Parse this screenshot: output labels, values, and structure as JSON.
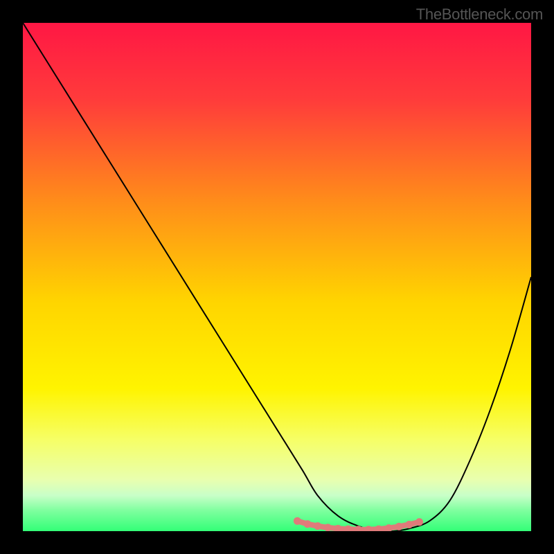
{
  "watermark": "TheBottleneck.com",
  "chart_data": {
    "type": "line",
    "title": "",
    "xlabel": "",
    "ylabel": "",
    "xlim": [
      0,
      100
    ],
    "ylim": [
      0,
      100
    ],
    "gradient_stops": [
      {
        "offset": 0,
        "color": "#ff1744"
      },
      {
        "offset": 15,
        "color": "#ff3b3b"
      },
      {
        "offset": 35,
        "color": "#ff8c1a"
      },
      {
        "offset": 55,
        "color": "#ffd500"
      },
      {
        "offset": 72,
        "color": "#fff400"
      },
      {
        "offset": 82,
        "color": "#f6ff66"
      },
      {
        "offset": 90,
        "color": "#e8ffb0"
      },
      {
        "offset": 93,
        "color": "#c8ffc8"
      },
      {
        "offset": 96,
        "color": "#7dff9e"
      },
      {
        "offset": 100,
        "color": "#33ff77"
      }
    ],
    "series": [
      {
        "name": "bottleneck-curve",
        "color": "#000000",
        "x": [
          0,
          5,
          10,
          15,
          20,
          25,
          30,
          35,
          40,
          45,
          50,
          55,
          58,
          62,
          66,
          70,
          73,
          76,
          80,
          84,
          88,
          92,
          96,
          100
        ],
        "y": [
          100,
          92,
          84,
          76,
          68,
          60,
          52,
          44,
          36,
          28,
          20,
          12,
          7,
          3,
          1,
          0,
          0,
          0.5,
          2,
          6,
          14,
          24,
          36,
          50
        ]
      },
      {
        "name": "highlight-band",
        "color": "#e07a7a",
        "marker": true,
        "x": [
          54,
          56,
          58,
          60,
          62,
          64,
          66,
          68,
          70,
          72,
          74,
          76,
          78
        ],
        "y": [
          2.0,
          1.4,
          1.0,
          0.7,
          0.5,
          0.4,
          0.3,
          0.3,
          0.4,
          0.6,
          0.9,
          1.3,
          1.8
        ]
      }
    ]
  }
}
